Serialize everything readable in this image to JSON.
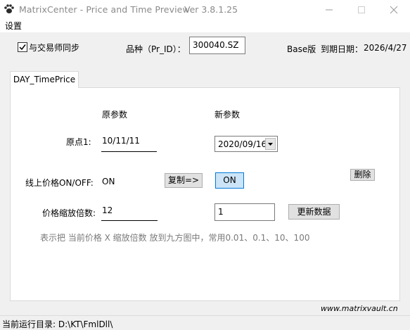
{
  "window": {
    "title": "MatrixCenter - Price and Time Preview",
    "version": "Ver 3.8.1.25"
  },
  "menu": {
    "settings": "设置"
  },
  "top": {
    "sync_label": "与交易师同步",
    "sync_checked": true,
    "product_label": "品种（Pr_ID）：",
    "product_value": "300040.SZ",
    "edition": "Base版",
    "expiry_label": "到期日期：",
    "expiry_value": "2026/4/27"
  },
  "tabs": [
    {
      "label": "DAY_TimePrice"
    }
  ],
  "panel": {
    "orig_header": "原参数",
    "new_header": "新参数",
    "origin_label": "原点1:",
    "origin_orig_value": "10/11/11",
    "origin_new_value": "2020/09/16",
    "online_label": "线上价格ON/OFF:",
    "online_orig_value": "ON",
    "copy_button": "复制=>",
    "online_new_value": "ON",
    "delete_button": "删除",
    "scale_label": "价格缩放倍数:",
    "scale_orig_value": "12",
    "scale_new_value": "1",
    "update_button": "更新数据",
    "hint": "表示把 当前价格 X 缩放倍数 放到九方图中，常用0.01、0.1、10、100"
  },
  "footer": {
    "website": "www.matrixvault.cn",
    "status_label": "当前运行目录:",
    "status_path": "D:\\KT\\FmlDll\\"
  },
  "colors": {
    "accent_blue": "#0078d7",
    "toggle_fill": "#cce4f7",
    "window_bg": "#f0f0f0"
  }
}
